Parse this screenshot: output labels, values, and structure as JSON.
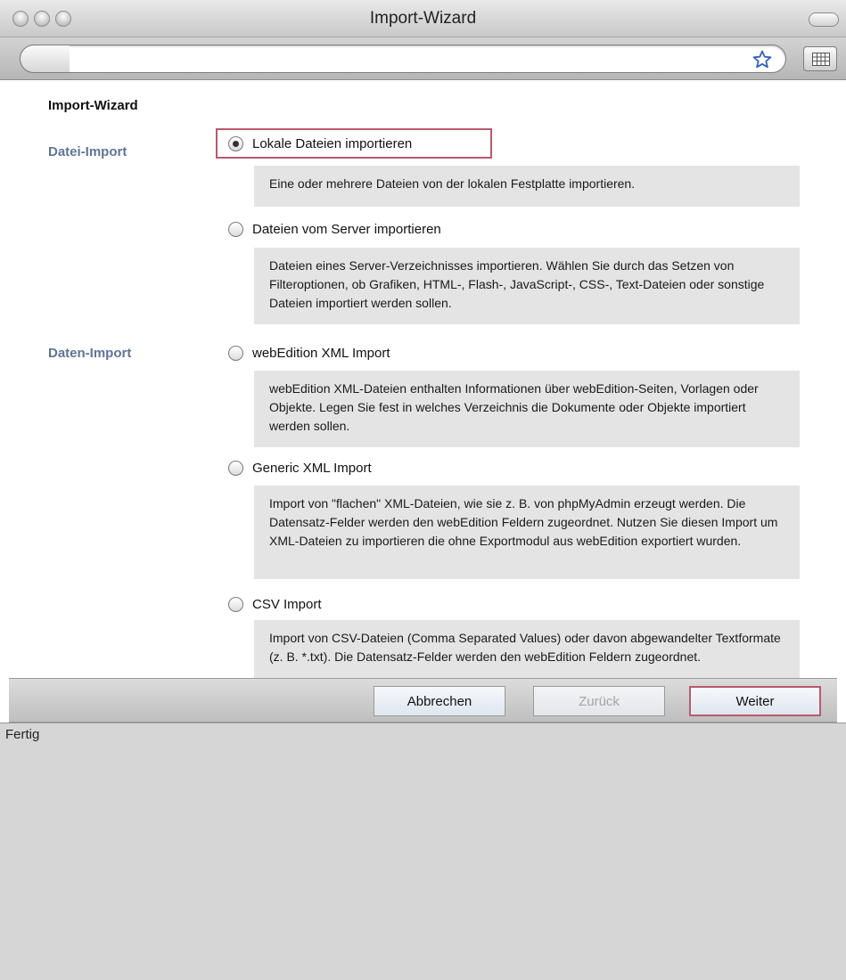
{
  "window": {
    "title": "Import-Wizard"
  },
  "toolbar": {
    "url_value": "",
    "star_icon": "bookmark-star-icon",
    "grid_icon": "grid-view-icon"
  },
  "wizard": {
    "heading": "Import-Wizard",
    "sections": {
      "datei": "Datei-Import",
      "daten": "Daten-Import"
    },
    "options": [
      {
        "label": "Lokale Dateien importieren",
        "selected": true,
        "description": "Eine oder mehrere Dateien von der lokalen Festplatte importieren."
      },
      {
        "label": "Dateien vom Server importieren",
        "selected": false,
        "description": "Dateien eines Server-Verzeichnisses importieren. Wählen Sie durch das Setzen von Filteroptionen, ob Grafiken, HTML-, Flash-, JavaScript-, CSS-, Text-Dateien oder sonstige Dateien importiert werden sollen."
      },
      {
        "label": "webEdition XML Import",
        "selected": false,
        "description": "webEdition XML-Dateien enthalten Informationen über webEdition-Seiten, Vorlagen oder Objekte. Legen Sie fest in welches Verzeichnis die Dokumente oder Objekte importiert werden sollen."
      },
      {
        "label": "Generic XML Import",
        "selected": false,
        "description": "Import von \"flachen\" XML-Dateien, wie sie z. B. von phpMyAdmin erzeugt werden. Die Datensatz-Felder werden den webEdition Feldern zugeordnet. Nutzen Sie diesen Import um XML-Dateien zu importieren die ohne Exportmodul aus webEdition exportiert wurden."
      },
      {
        "label": "CSV Import",
        "selected": false,
        "description": "Import von CSV-Dateien (Comma Separated Values) oder davon abgewandelter Textformate (z. B. *.txt). Die Datensatz-Felder werden den webEdition Feldern zugeordnet."
      }
    ]
  },
  "buttons": {
    "cancel": "Abbrechen",
    "back": "Zurück",
    "next": "Weiter"
  },
  "status": {
    "text": "Fertig"
  },
  "colors": {
    "section_label": "#5e7598",
    "highlight_border": "#b85a6e",
    "desc_bg": "#e4e4e4"
  }
}
